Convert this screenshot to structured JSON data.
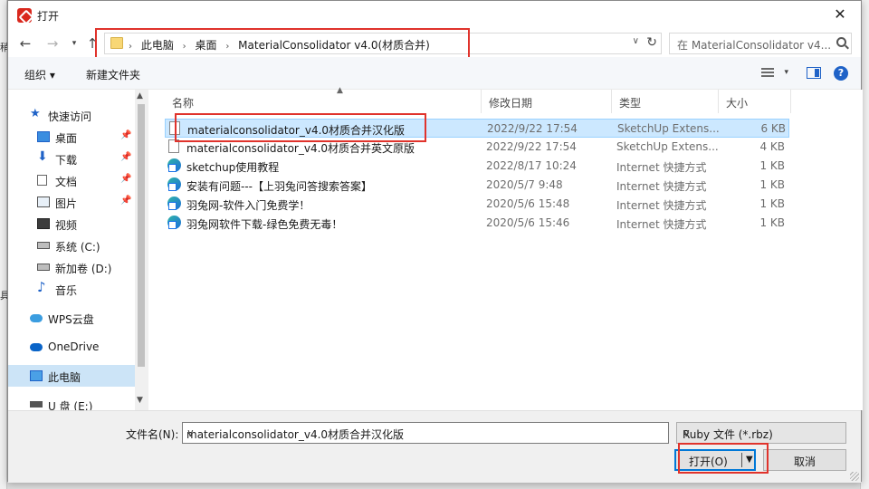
{
  "window": {
    "title": "打开"
  },
  "address": {
    "crumbs": [
      "此电脑",
      "桌面",
      "MaterialConsolidator v4.0(材质合并)"
    ],
    "search_placeholder": "在 MaterialConsolidator v4..."
  },
  "toolbar": {
    "organize": "组织 ▾",
    "new_folder": "新建文件夹"
  },
  "sidebar": {
    "items": [
      {
        "label": "快速访问",
        "icon": "star-icon"
      },
      {
        "label": "桌面",
        "icon": "desktop-icon",
        "pinned": true
      },
      {
        "label": "下载",
        "icon": "download-icon",
        "pinned": true
      },
      {
        "label": "文档",
        "icon": "document-icon",
        "pinned": true
      },
      {
        "label": "图片",
        "icon": "picture-icon",
        "pinned": true
      },
      {
        "label": "视频",
        "icon": "video-icon"
      },
      {
        "label": "系统 (C:)",
        "icon": "drive-icon"
      },
      {
        "label": "新加卷 (D:)",
        "icon": "drive-icon"
      },
      {
        "label": "音乐",
        "icon": "music-icon"
      },
      {
        "label": "WPS云盘",
        "icon": "cloud-icon"
      },
      {
        "label": "OneDrive",
        "icon": "onedrive-icon"
      },
      {
        "label": "此电脑",
        "icon": "computer-icon",
        "selected": true
      },
      {
        "label": "U 盘 (E:)",
        "icon": "usb-icon"
      }
    ]
  },
  "columns": {
    "name": "名称",
    "date": "修改日期",
    "type": "类型",
    "size": "大小"
  },
  "files": [
    {
      "name": "materialconsolidator_v4.0材质合并汉化版",
      "date": "2022/9/22 17:54",
      "type": "SketchUp Extens...",
      "size": "6 KB",
      "icon": "file-icon",
      "selected": true
    },
    {
      "name": "materialconsolidator_v4.0材质合并英文原版",
      "date": "2022/9/22 17:54",
      "type": "SketchUp Extens...",
      "size": "4 KB",
      "icon": "file-icon"
    },
    {
      "name": "sketchup使用教程",
      "date": "2022/8/17 10:24",
      "type": "Internet 快捷方式",
      "size": "1 KB",
      "icon": "web-shortcut-icon"
    },
    {
      "name": "安装有问题---【上羽兔问答搜索答案】",
      "date": "2020/5/7 9:48",
      "type": "Internet 快捷方式",
      "size": "1 KB",
      "icon": "web-shortcut-icon"
    },
    {
      "name": "羽兔网-软件入门免费学！",
      "date": "2020/5/6 15:48",
      "type": "Internet 快捷方式",
      "size": "1 KB",
      "icon": "web-shortcut-icon"
    },
    {
      "name": "羽兔网软件下载-绿色免费无毒！",
      "date": "2020/5/6 15:46",
      "type": "Internet 快捷方式",
      "size": "1 KB",
      "icon": "web-shortcut-icon"
    }
  ],
  "footer": {
    "filename_label": "文件名(N):",
    "filename_value": "materialconsolidator_v4.0材质合并汉化版",
    "filetype": "Ruby 文件 (*.rbz)",
    "open": "打开(O)",
    "cancel": "取消"
  },
  "background": {
    "left_glyph_1": "稍",
    "left_glyph_2": "具"
  },
  "colors": {
    "highlight_red": "#e0332c",
    "selection": "#cce8ff",
    "accent": "#0078d7"
  }
}
